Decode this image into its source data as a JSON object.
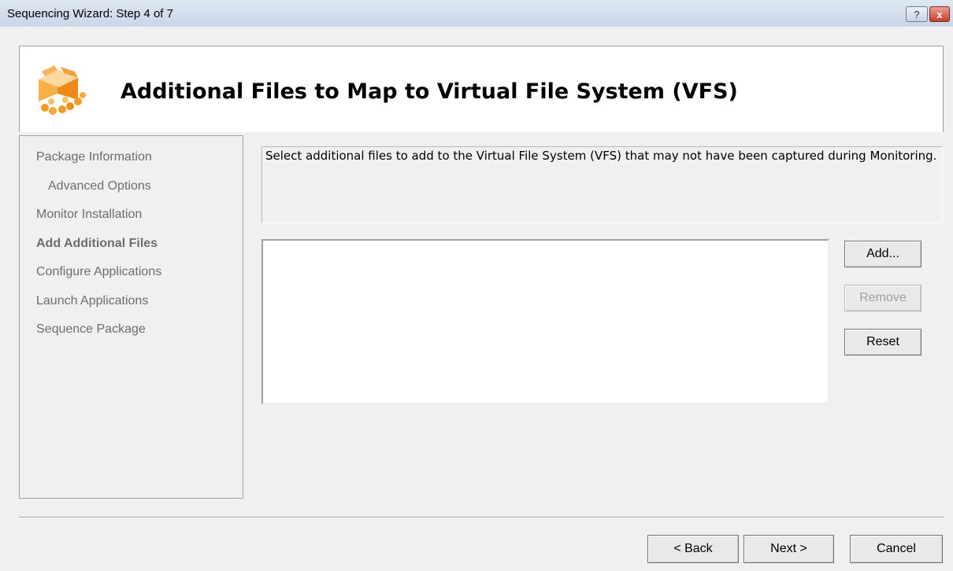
{
  "window": {
    "title": "Sequencing Wizard: Step 4 of 7",
    "help_label": "?",
    "close_label": "x"
  },
  "header": {
    "title": "Additional Files to Map to Virtual File System (VFS)",
    "icon": "package-box-icon"
  },
  "nav": {
    "items": [
      {
        "label": "Package Information",
        "state": "done"
      },
      {
        "label": "Advanced Options",
        "state": "done",
        "indented": true
      },
      {
        "label": "Monitor Installation",
        "state": "done"
      },
      {
        "label": "Add Additional Files",
        "state": "current"
      },
      {
        "label": "Configure Applications",
        "state": "pending"
      },
      {
        "label": "Launch Applications",
        "state": "pending"
      },
      {
        "label": "Sequence Package",
        "state": "pending"
      }
    ]
  },
  "main": {
    "description": "Select additional files to add to the Virtual File System (VFS) that may not have been captured during Monitoring.",
    "file_list": [],
    "buttons": {
      "add": "Add...",
      "remove": "Remove",
      "reset": "Reset"
    }
  },
  "footer": {
    "back": "< Back",
    "next": "Next >",
    "cancel": "Cancel"
  },
  "colors": {
    "accent": "#f59a23",
    "window_bg": "#f0f0f0",
    "disabled_text": "#a0a0a0"
  }
}
